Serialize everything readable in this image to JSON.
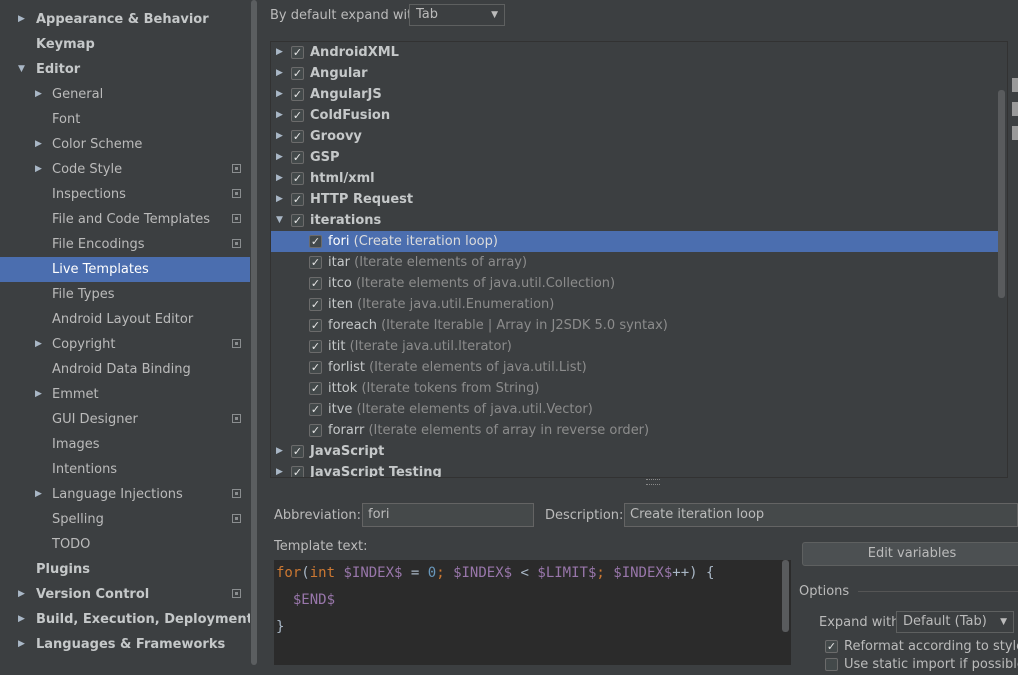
{
  "sidebar": {
    "items": [
      {
        "label": "Appearance & Behavior",
        "level": 0,
        "expander": "collapsed",
        "selected": false,
        "project": false
      },
      {
        "label": "Keymap",
        "level": 0,
        "expander": "none",
        "selected": false,
        "project": false
      },
      {
        "label": "Editor",
        "level": 0,
        "expander": "expanded",
        "selected": false,
        "project": false
      },
      {
        "label": "General",
        "level": 1,
        "expander": "collapsed",
        "selected": false,
        "project": false
      },
      {
        "label": "Font",
        "level": 1,
        "expander": "none",
        "selected": false,
        "project": false
      },
      {
        "label": "Color Scheme",
        "level": 1,
        "expander": "collapsed",
        "selected": false,
        "project": false
      },
      {
        "label": "Code Style",
        "level": 1,
        "expander": "collapsed",
        "selected": false,
        "project": true
      },
      {
        "label": "Inspections",
        "level": 1,
        "expander": "none",
        "selected": false,
        "project": true
      },
      {
        "label": "File and Code Templates",
        "level": 1,
        "expander": "none",
        "selected": false,
        "project": true
      },
      {
        "label": "File Encodings",
        "level": 1,
        "expander": "none",
        "selected": false,
        "project": true
      },
      {
        "label": "Live Templates",
        "level": 1,
        "expander": "none",
        "selected": true,
        "project": false
      },
      {
        "label": "File Types",
        "level": 1,
        "expander": "none",
        "selected": false,
        "project": false
      },
      {
        "label": "Android Layout Editor",
        "level": 1,
        "expander": "none",
        "selected": false,
        "project": false
      },
      {
        "label": "Copyright",
        "level": 1,
        "expander": "collapsed",
        "selected": false,
        "project": true
      },
      {
        "label": "Android Data Binding",
        "level": 1,
        "expander": "none",
        "selected": false,
        "project": false
      },
      {
        "label": "Emmet",
        "level": 1,
        "expander": "collapsed",
        "selected": false,
        "project": false
      },
      {
        "label": "GUI Designer",
        "level": 1,
        "expander": "none",
        "selected": false,
        "project": true
      },
      {
        "label": "Images",
        "level": 1,
        "expander": "none",
        "selected": false,
        "project": false
      },
      {
        "label": "Intentions",
        "level": 1,
        "expander": "none",
        "selected": false,
        "project": false
      },
      {
        "label": "Language Injections",
        "level": 1,
        "expander": "collapsed",
        "selected": false,
        "project": true
      },
      {
        "label": "Spelling",
        "level": 1,
        "expander": "none",
        "selected": false,
        "project": true
      },
      {
        "label": "TODO",
        "level": 1,
        "expander": "none",
        "selected": false,
        "project": false
      },
      {
        "label": "Plugins",
        "level": 0,
        "expander": "none",
        "selected": false,
        "project": false
      },
      {
        "label": "Version Control",
        "level": 0,
        "expander": "collapsed",
        "selected": false,
        "project": true
      },
      {
        "label": "Build, Execution, Deployment",
        "level": 0,
        "expander": "collapsed",
        "selected": false,
        "project": false
      },
      {
        "label": "Languages & Frameworks",
        "level": 0,
        "expander": "collapsed",
        "selected": false,
        "project": false
      }
    ]
  },
  "header": {
    "expand_label": "By default expand with",
    "expand_value": "Tab"
  },
  "templates": {
    "rows": [
      {
        "kind": "group",
        "name": "AndroidXML",
        "desc": "",
        "expander": "collapsed",
        "checked": true,
        "selected": false
      },
      {
        "kind": "group",
        "name": "Angular",
        "desc": "",
        "expander": "collapsed",
        "checked": true,
        "selected": false
      },
      {
        "kind": "group",
        "name": "AngularJS",
        "desc": "",
        "expander": "collapsed",
        "checked": true,
        "selected": false
      },
      {
        "kind": "group",
        "name": "ColdFusion",
        "desc": "",
        "expander": "collapsed",
        "checked": true,
        "selected": false
      },
      {
        "kind": "group",
        "name": "Groovy",
        "desc": "",
        "expander": "collapsed",
        "checked": true,
        "selected": false
      },
      {
        "kind": "group",
        "name": "GSP",
        "desc": "",
        "expander": "collapsed",
        "checked": true,
        "selected": false
      },
      {
        "kind": "group",
        "name": "html/xml",
        "desc": "",
        "expander": "collapsed",
        "checked": true,
        "selected": false
      },
      {
        "kind": "group",
        "name": "HTTP Request",
        "desc": "",
        "expander": "collapsed",
        "checked": true,
        "selected": false
      },
      {
        "kind": "group",
        "name": "iterations",
        "desc": "",
        "expander": "expanded",
        "checked": true,
        "selected": false
      },
      {
        "kind": "child",
        "name": "fori",
        "desc": "(Create iteration loop)",
        "checked": true,
        "selected": true
      },
      {
        "kind": "child",
        "name": "itar",
        "desc": "(Iterate elements of array)",
        "checked": true,
        "selected": false
      },
      {
        "kind": "child",
        "name": "itco",
        "desc": "(Iterate elements of java.util.Collection)",
        "checked": true,
        "selected": false
      },
      {
        "kind": "child",
        "name": "iten",
        "desc": "(Iterate java.util.Enumeration)",
        "checked": true,
        "selected": false
      },
      {
        "kind": "child",
        "name": "foreach",
        "desc": "(Iterate Iterable | Array in J2SDK 5.0 syntax)",
        "checked": true,
        "selected": false
      },
      {
        "kind": "child",
        "name": "itit",
        "desc": "(Iterate java.util.Iterator)",
        "checked": true,
        "selected": false
      },
      {
        "kind": "child",
        "name": "forlist",
        "desc": "(Iterate elements of java.util.List)",
        "checked": true,
        "selected": false
      },
      {
        "kind": "child",
        "name": "ittok",
        "desc": "(Iterate tokens from String)",
        "checked": true,
        "selected": false
      },
      {
        "kind": "child",
        "name": "itve",
        "desc": "(Iterate elements of java.util.Vector)",
        "checked": true,
        "selected": false
      },
      {
        "kind": "child",
        "name": "forarr",
        "desc": "(Iterate elements of array in reverse order)",
        "checked": true,
        "selected": false
      },
      {
        "kind": "group",
        "name": "JavaScript",
        "desc": "",
        "expander": "collapsed",
        "checked": true,
        "selected": false
      },
      {
        "kind": "group",
        "name": "JavaScript Testing",
        "desc": "",
        "expander": "collapsed",
        "checked": true,
        "selected": false
      }
    ]
  },
  "form": {
    "abbreviation_label": "Abbreviation:",
    "abbreviation_value": "fori",
    "description_label": "Description:",
    "description_value": "Create iteration loop",
    "template_text_label": "Template text:",
    "edit_variables_label": "Edit variables"
  },
  "editor": {
    "lines": [
      [
        {
          "t": "for",
          "c": "kw"
        },
        {
          "t": "(",
          "c": "plain"
        },
        {
          "t": "int",
          "c": "kw"
        },
        {
          "t": " ",
          "c": "plain"
        },
        {
          "t": "$INDEX$",
          "c": "var"
        },
        {
          "t": " = ",
          "c": "plain"
        },
        {
          "t": "0",
          "c": "num"
        },
        {
          "t": "; ",
          "c": "kw"
        },
        {
          "t": "$INDEX$",
          "c": "var"
        },
        {
          "t": " < ",
          "c": "plain"
        },
        {
          "t": "$LIMIT$",
          "c": "var"
        },
        {
          "t": "; ",
          "c": "kw"
        },
        {
          "t": "$INDEX$",
          "c": "var"
        },
        {
          "t": "++) {",
          "c": "plain"
        }
      ],
      [
        {
          "t": "  ",
          "c": "plain"
        },
        {
          "t": "$END$",
          "c": "var"
        }
      ],
      [
        {
          "t": "}",
          "c": "plain"
        }
      ]
    ]
  },
  "options": {
    "title": "Options",
    "expand_with_label": "Expand with",
    "expand_with_value": "Default (Tab)",
    "reformat_label": "Reformat according to style",
    "reformat_checked": true,
    "static_import_label": "Use static import if possible",
    "static_import_checked": false
  },
  "colors": {
    "background": "#3c3f41",
    "selection": "#4b6eaf",
    "editor_background": "#2b2b2b",
    "keyword": "#cc7832",
    "number": "#6897bb",
    "variable": "#9876aa"
  },
  "icons": {
    "collapsed": "triangle-right-icon",
    "expanded": "triangle-down-icon",
    "project_level": "project-settings-icon",
    "checkbox": "check-icon",
    "dropdown": "chevron-down-icon"
  }
}
